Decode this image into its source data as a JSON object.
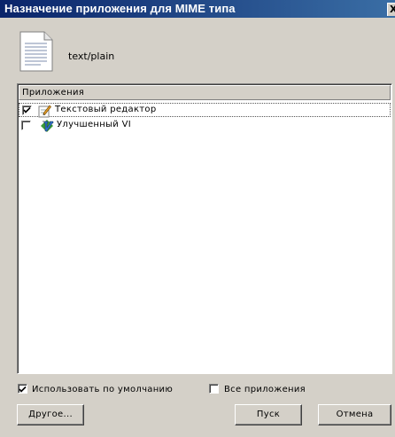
{
  "window": {
    "title": "Назначение приложения для MIME типа",
    "close_glyph": "X"
  },
  "mime": {
    "type": "text/plain",
    "icon": "text-file-icon"
  },
  "applications": {
    "header": "Приложения",
    "items": [
      {
        "label": "Текстовый редактор",
        "checked": true,
        "icon": "text-editor-icon"
      },
      {
        "label": "Улучшенный VI",
        "checked": false,
        "icon": "vim-icon"
      }
    ]
  },
  "options": {
    "use_default": {
      "label": "Использовать по умолчанию",
      "checked": true
    },
    "all_apps": {
      "label": "Все приложения",
      "checked": false
    }
  },
  "buttons": {
    "other": "Другое...",
    "run": "Пуск",
    "cancel": "Отмена"
  },
  "colors": {
    "titlebar_start": "#0a246a",
    "titlebar_end": "#3a6ea5",
    "face": "#d4d0c8"
  }
}
